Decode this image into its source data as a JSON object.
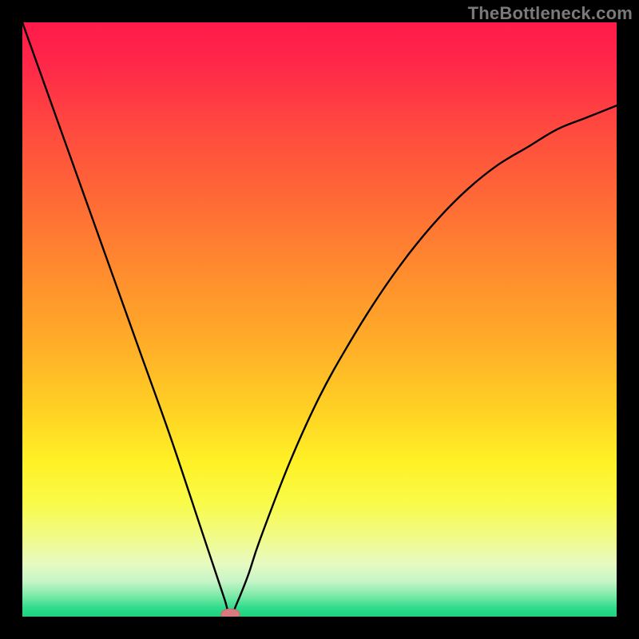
{
  "attribution": "TheBottleneck.com",
  "colors": {
    "frame": "#000000",
    "attribution_text": "#7a7a7a",
    "curve": "#000000",
    "marker_fill": "#d97a7f",
    "marker_stroke": "#c46a6f",
    "gradient_stops": [
      {
        "offset": 0.0,
        "color": "#ff1a4b"
      },
      {
        "offset": 0.08,
        "color": "#ff2a48"
      },
      {
        "offset": 0.18,
        "color": "#ff4a3f"
      },
      {
        "offset": 0.3,
        "color": "#ff6a36"
      },
      {
        "offset": 0.42,
        "color": "#ff8c2e"
      },
      {
        "offset": 0.55,
        "color": "#ffb028"
      },
      {
        "offset": 0.66,
        "color": "#ffd424"
      },
      {
        "offset": 0.74,
        "color": "#fff126"
      },
      {
        "offset": 0.81,
        "color": "#f9fb4a"
      },
      {
        "offset": 0.87,
        "color": "#f0fb8c"
      },
      {
        "offset": 0.91,
        "color": "#e7fac0"
      },
      {
        "offset": 0.94,
        "color": "#c8f5c8"
      },
      {
        "offset": 0.965,
        "color": "#7de9a8"
      },
      {
        "offset": 0.985,
        "color": "#2fdc8c"
      },
      {
        "offset": 1.0,
        "color": "#1fd07f"
      }
    ]
  },
  "chart_data": {
    "type": "line",
    "title": "",
    "xlabel": "",
    "ylabel": "",
    "xlim": [
      0,
      100
    ],
    "ylim": [
      0,
      100
    ],
    "grid": false,
    "legend": false,
    "series": [
      {
        "name": "bottleneck-curve",
        "x": [
          0,
          5,
          10,
          15,
          20,
          25,
          30,
          32,
          34,
          35,
          36,
          38,
          40,
          45,
          50,
          55,
          60,
          65,
          70,
          75,
          80,
          85,
          90,
          95,
          100
        ],
        "y": [
          100,
          86,
          72,
          58,
          44,
          30,
          15,
          9,
          3,
          0,
          2,
          7,
          13,
          26,
          37,
          46,
          54,
          61,
          67,
          72,
          76,
          79,
          82,
          84,
          86
        ]
      }
    ],
    "marker": {
      "x": 35,
      "y": 0,
      "rx": 1.6,
      "ry": 0.9
    },
    "notes": "x and y are normalized 0-100 within the gradient plot area; y increases upward. Values estimated from pixels; axes unlabeled in source."
  }
}
